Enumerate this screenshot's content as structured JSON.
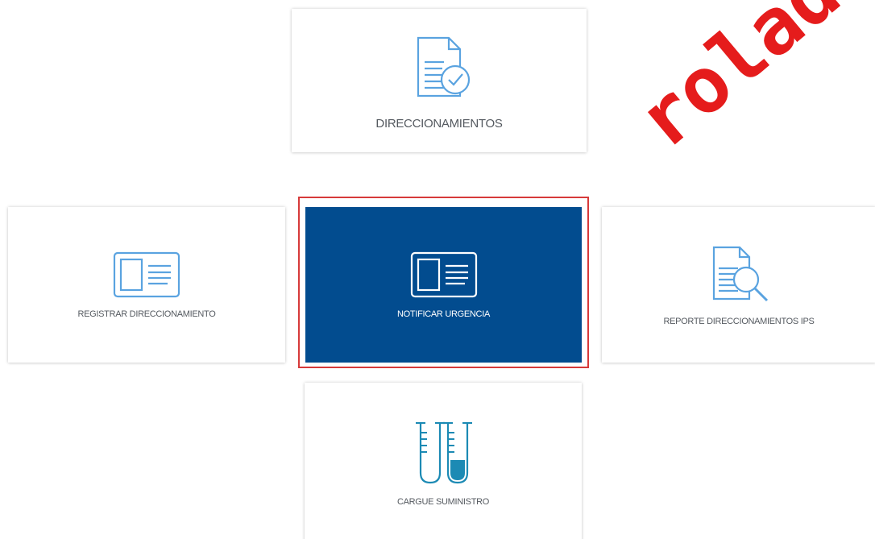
{
  "colors": {
    "accent_blue": "#024c8f",
    "icon_light_blue": "#5aa3e0",
    "icon_teal": "#1c8ab4",
    "selection_red": "#d73a3a",
    "watermark_red": "#e51c1c"
  },
  "cards": {
    "direccionamientos": {
      "label": "DIRECCIONAMIENTOS",
      "icon": "document-check-icon"
    },
    "registrar": {
      "label": "REGISTRAR DIRECCIONAMIENTO",
      "icon": "id-card-icon"
    },
    "notificar": {
      "label": "NOTIFICAR URGENCIA",
      "icon": "id-card-icon",
      "selected": true
    },
    "reporte": {
      "label": "REPORTE DIRECCIONAMIENTOS IPS",
      "icon": "document-search-icon"
    },
    "cargue": {
      "label": "CARGUE SUMINISTRO",
      "icon": "test-tubes-icon"
    }
  },
  "watermark": {
    "text": "rolada"
  }
}
